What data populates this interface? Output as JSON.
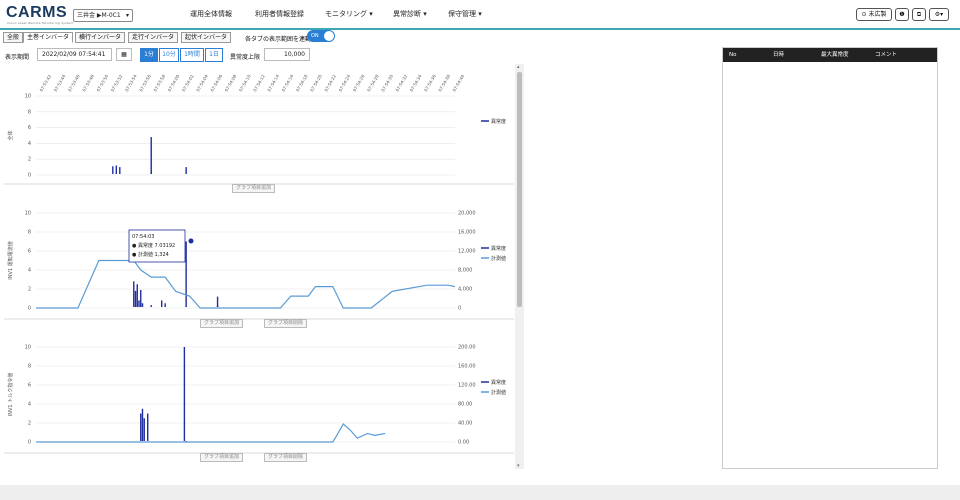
{
  "app": {
    "logo": "CARMS",
    "logo_sub": "Cloud Asset Remote Monitoring System",
    "site_selector": "三井金 ▶M-0C1"
  },
  "nav": {
    "items": [
      "運用全体情報",
      "利用者情報登録",
      "モニタリング ▾",
      "異常診断 ▾",
      "保守管理 ▾"
    ]
  },
  "header_right": {
    "user": "⊙ 末広製",
    "icons": [
      "info-icon",
      "chat-icon",
      "settings-icon"
    ]
  },
  "tabs": [
    "全般",
    "主巻インバータ",
    "横行インバータ",
    "走行インバータ",
    "起伏インバータ"
  ],
  "controls": {
    "all_tabs_label": "各タブの表示範囲を連動",
    "toggle": "ON",
    "display_period_label": "表示期間",
    "display_period_value": "2022/02/09 07:54:41",
    "ranges": [
      "1分",
      "10分",
      "1時間",
      "1日"
    ],
    "active_range": "1分",
    "anomaly_upper_label": "異常度上限",
    "anomaly_upper_value": "10,000"
  },
  "buttons": {
    "add_graph": "グラフ項目追加",
    "remove_graph": "グラフ項目削除"
  },
  "side_panel": {
    "columns": [
      "No",
      "日時",
      "最大異常度",
      "コメント"
    ]
  },
  "chart_data": [
    {
      "type": "line",
      "ylabel": "全体",
      "ylim": [
        0,
        10
      ],
      "yticks": [
        0,
        2,
        4,
        6,
        8,
        10
      ],
      "x_ticks": [
        "07:53:42",
        "07:53:44",
        "07:53:46",
        "07:53:48",
        "07:53:50",
        "07:53:52",
        "07:53:54",
        "07:53:56",
        "07:53:58",
        "07:54:00",
        "07:54:02",
        "07:54:04",
        "07:54:06",
        "07:54:08",
        "07:54:10",
        "07:54:12",
        "07:54:14",
        "07:54:16",
        "07:54:18",
        "07:54:20",
        "07:54:22",
        "07:54:24",
        "07:54:26",
        "07:54:28",
        "07:54:30",
        "07:54:32",
        "07:54:34",
        "07:54:36",
        "07:54:38",
        "07:54:40"
      ],
      "series": [
        {
          "name": "異常度",
          "points": [
            [
              0.22,
              1.1
            ],
            [
              0.23,
              1.2
            ],
            [
              0.24,
              1.0
            ],
            [
              0.33,
              4.8
            ],
            [
              0.33,
              0.5
            ],
            [
              0.43,
              1.0
            ]
          ]
        }
      ]
    },
    {
      "type": "line",
      "ylabel": "INV1 運転電流値",
      "ylim": [
        0,
        10
      ],
      "yticks": [
        0,
        2,
        4,
        6,
        8,
        10
      ],
      "y2lim": [
        0,
        20000
      ],
      "y2ticks": [
        "0",
        "4,000",
        "8,000",
        "12,000",
        "16,000",
        "20,000"
      ],
      "tooltip": {
        "time": "07:54:03",
        "anomaly": "● 異常度 7.03192",
        "value": "● 計測値 1,324"
      },
      "series": [
        {
          "name": "異常度",
          "points": [
            [
              0.28,
              2.8
            ],
            [
              0.285,
              1.8
            ],
            [
              0.29,
              2.5
            ],
            [
              0.295,
              0.8
            ],
            [
              0.3,
              1.9
            ],
            [
              0.305,
              0.5
            ],
            [
              0.33,
              0.3
            ],
            [
              0.36,
              0.8
            ],
            [
              0.37,
              0.5
            ],
            [
              0.43,
              7.0
            ],
            [
              0.43,
              0.2
            ],
            [
              0.52,
              1.2
            ],
            [
              0.52,
              0.3
            ]
          ]
        },
        {
          "name": "計測値",
          "points": [
            [
              0,
              0
            ],
            [
              0.12,
              0
            ],
            [
              0.18,
              10000
            ],
            [
              0.28,
              10000
            ],
            [
              0.3,
              8000
            ],
            [
              0.33,
              6500
            ],
            [
              0.37,
              6500
            ],
            [
              0.4,
              3500
            ],
            [
              0.44,
              2500
            ],
            [
              0.47,
              0
            ],
            [
              0.7,
              0
            ],
            [
              0.73,
              2500
            ],
            [
              0.78,
              2500
            ],
            [
              0.8,
              4500
            ],
            [
              0.85,
              4500
            ],
            [
              0.88,
              0
            ],
            [
              0.96,
              0
            ],
            [
              1.02,
              3500
            ],
            [
              1.12,
              4800
            ],
            [
              1.18,
              4800
            ],
            [
              1.2,
              4500
            ]
          ]
        }
      ]
    },
    {
      "type": "line",
      "ylabel": "INV1 トルク指令値",
      "ylim": [
        0,
        10
      ],
      "yticks": [
        0,
        2,
        4,
        6,
        8,
        10
      ],
      "y2lim": [
        0,
        200
      ],
      "y2ticks": [
        "0.00",
        "40.00",
        "80.00",
        "120.00",
        "160.00",
        "200.00"
      ],
      "series": [
        {
          "name": "異常度",
          "points": [
            [
              0.3,
              3.0
            ],
            [
              0.305,
              3.5
            ],
            [
              0.31,
              2.5
            ],
            [
              0.32,
              3.0
            ],
            [
              0.425,
              10.0
            ],
            [
              0.43,
              0.0
            ]
          ]
        },
        {
          "name": "計測値",
          "points": [
            [
              0,
              0
            ],
            [
              0.85,
              0
            ],
            [
              0.86,
              12
            ],
            [
              0.88,
              38
            ],
            [
              0.9,
              25
            ],
            [
              0.92,
              8
            ],
            [
              0.95,
              18
            ],
            [
              0.97,
              14
            ],
            [
              1.0,
              18
            ]
          ]
        }
      ]
    }
  ]
}
